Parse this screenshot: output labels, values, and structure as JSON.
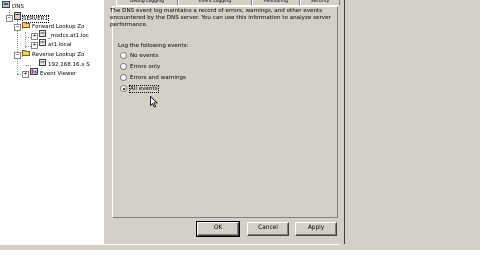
{
  "tree": {
    "items": [
      {
        "label": "DNS",
        "indent": 0
      },
      {
        "label": "SERVER1",
        "indent": 1
      },
      {
        "label": "Forward Lookup Zo",
        "indent": 2
      },
      {
        "label": "_msdcs.at1.loc",
        "indent": 3
      },
      {
        "label": "at1.local",
        "indent": 3
      },
      {
        "label": "Reverse Lookup Zo",
        "indent": 2
      },
      {
        "label": "192.168.16.x S",
        "indent": 3
      },
      {
        "label": "Event Viewer",
        "indent": 2
      }
    ]
  },
  "dialog": {
    "tabs": [
      "Debug Logging",
      "Event Logging",
      "Monitoring",
      "Security"
    ],
    "description": "The DNS event log maintains a record of errors, warnings, and other events encountered by the DNS server. You can use this information to analyze server performance.",
    "log_label": "Log the following events:",
    "options": [
      "No events",
      "Errors only",
      "Errors and warnings",
      "All events"
    ],
    "selected_index": 3,
    "buttons": {
      "ok": "OK",
      "cancel": "Cancel",
      "apply": "Apply"
    }
  }
}
